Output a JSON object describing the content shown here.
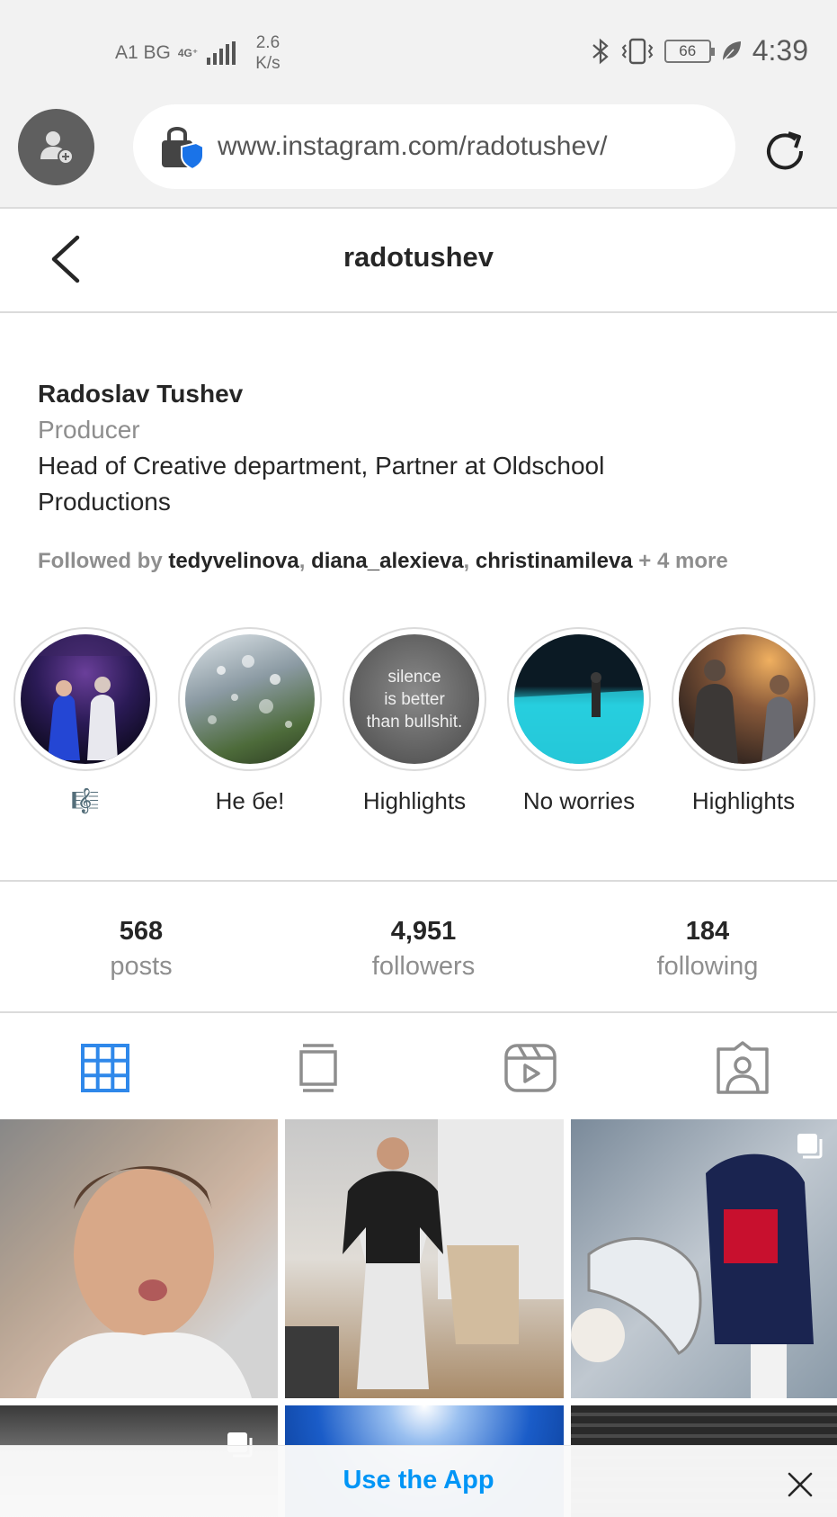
{
  "status_bar": {
    "carrier": "A1 BG",
    "network": "4G⁺",
    "speed_value": "2.6",
    "speed_unit": "K/s",
    "battery": "66",
    "time": "4:39"
  },
  "browser": {
    "url": "www.instagram.com/radotushev/"
  },
  "profile": {
    "username": "radotushev",
    "full_name": "Radoslav Tushev",
    "category": "Producer",
    "bio_line1": "Head of Creative department, Partner at Oldschool",
    "bio_line2": "Productions",
    "followed_by_prefix": "Followed by ",
    "followed_by_users": [
      "tedyvelinova",
      "diana_alexieva",
      "christinamileva"
    ],
    "followed_by_separator": ", ",
    "followed_by_more": " + 4 more"
  },
  "highlights": [
    {
      "label": "🎼"
    },
    {
      "label": "Не бе!"
    },
    {
      "label": "Highlights",
      "cover_text_1": "silence",
      "cover_text_2": "is better",
      "cover_text_3": "than bullshit."
    },
    {
      "label": "No worries"
    },
    {
      "label": "Highlights"
    }
  ],
  "stats": {
    "posts": {
      "value": "568",
      "label": "posts"
    },
    "followers": {
      "value": "4,951",
      "label": "followers"
    },
    "following": {
      "value": "184",
      "label": "following"
    }
  },
  "tabs": [
    "grid-tab",
    "feed-tab",
    "reels-tab",
    "tagged-tab"
  ],
  "banner": {
    "link_text": "Use the App"
  },
  "colors": {
    "accent": "#0095f6",
    "active_tab": "#2f88ea",
    "text": "#262626",
    "secondary_text": "#8e8e8e"
  }
}
